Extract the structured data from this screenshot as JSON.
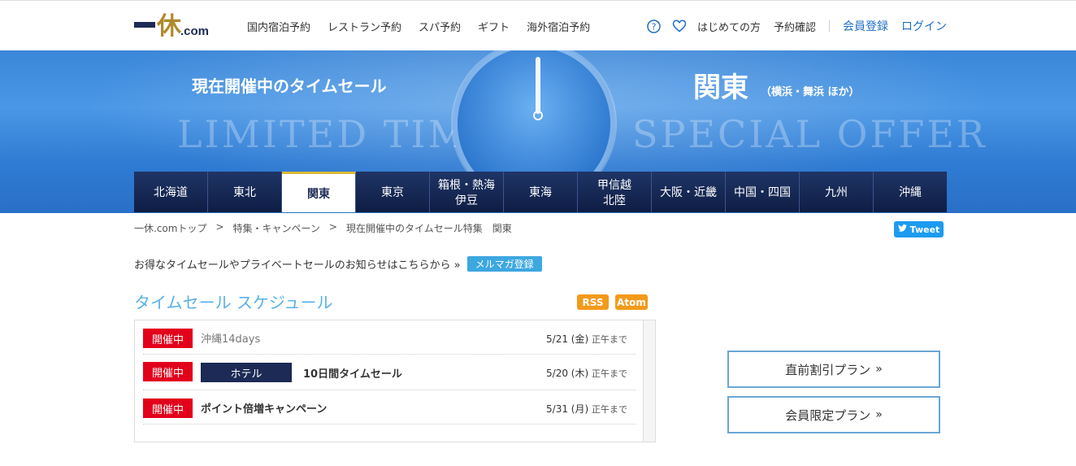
{
  "header": {
    "logo_text": "一休",
    "logo_suffix": ".com",
    "nav": [
      "国内宿泊予約",
      "レストラン予約",
      "スパ予約",
      "ギフト",
      "海外宿泊予約"
    ],
    "help_icon": "help-circle-icon",
    "favorite_icon": "heart-icon",
    "user_links": [
      "はじめての方",
      "予約確認"
    ],
    "register": "会員登録",
    "login": "ログイン"
  },
  "banner": {
    "title": "現在開催中のタイムセール",
    "region": "関東",
    "region_sub": "（横浜・舞浜 ほか）",
    "watermark_left": "LIMITED TIME",
    "watermark_right": "SPECIAL OFFER"
  },
  "regions": [
    {
      "label": "北海道"
    },
    {
      "label": "東北"
    },
    {
      "label": "関東",
      "active": true
    },
    {
      "label": "東京"
    },
    {
      "label": "箱根・熱海\n伊豆"
    },
    {
      "label": "東海"
    },
    {
      "label": "甲信越\n北陸"
    },
    {
      "label": "大阪・近畿"
    },
    {
      "label": "中国・四国"
    },
    {
      "label": "九州"
    },
    {
      "label": "沖縄"
    }
  ],
  "breadcrumb": [
    "一休.comトップ",
    ">",
    "特集・キャンペーン",
    ">",
    "現在開催中のタイムセール特集　関東"
  ],
  "tweet": "Tweet",
  "newsletter": {
    "text": "お得なタイムセールやプライベートセールのお知らせはこちらから »",
    "button": "メルマガ登録"
  },
  "schedule": {
    "title": "タイムセール スケジュール",
    "rss": "RSS",
    "atom": "Atom",
    "items": [
      {
        "status": "開催中",
        "name": "沖縄14days",
        "date": "5/21 (金)",
        "until": "正午まで"
      },
      {
        "status": "開催中",
        "tag": "ホテル",
        "name": "10日間タイムセール",
        "date": "5/20 (木)",
        "until": "正午まで"
      },
      {
        "status": "開催中",
        "name": "ポイント倍増キャンペーン",
        "date": "5/31 (月)",
        "until": "正午まで"
      }
    ]
  },
  "plans": [
    {
      "label": "直前割引プラン",
      "arrow": "»"
    },
    {
      "label": "会員限定プラン",
      "arrow": "»"
    }
  ]
}
